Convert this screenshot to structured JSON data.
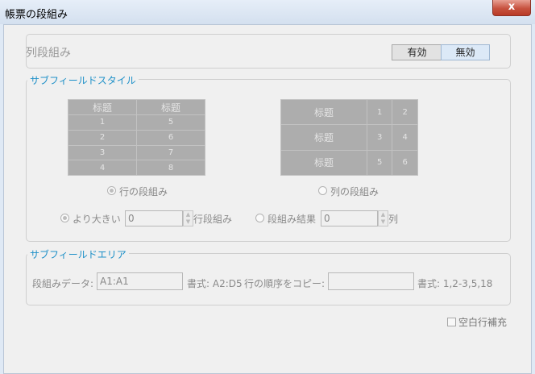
{
  "window": {
    "title": "帳票の段組み",
    "close_glyph": "x"
  },
  "column_layout": {
    "label": "列段組み",
    "enable_label": "有効",
    "disable_label": "無効"
  },
  "subfield_style": {
    "legend": "サブフィールドスタイル",
    "row_table": {
      "header": [
        "标题",
        "标题"
      ],
      "rows": [
        [
          "1",
          "5"
        ],
        [
          "2",
          "6"
        ],
        [
          "3",
          "7"
        ],
        [
          "4",
          "8"
        ]
      ]
    },
    "col_table": {
      "rows": [
        [
          "标题",
          "1",
          "2"
        ],
        [
          "标题",
          "3",
          "4"
        ],
        [
          "标题",
          "5",
          "6"
        ]
      ]
    },
    "row_option_label": "行の段組み",
    "col_option_label": "列の段組み",
    "greater_than_label": "より大きい",
    "greater_than_value": "0",
    "row_unit_label": "行段組み",
    "result_label": "段組み結果",
    "result_value": "0",
    "col_unit_label": "列"
  },
  "subfield_area": {
    "legend": "サブフィールドエリア",
    "data_label": "段組みデータ:",
    "data_value": "A1:A1",
    "data_format": "書式: A2:D5",
    "copy_label": "行の順序をコピー:",
    "copy_value": "",
    "copy_format": "書式: 1,2-3,5,18"
  },
  "fill_blank_rows_label": "空白行補充"
}
